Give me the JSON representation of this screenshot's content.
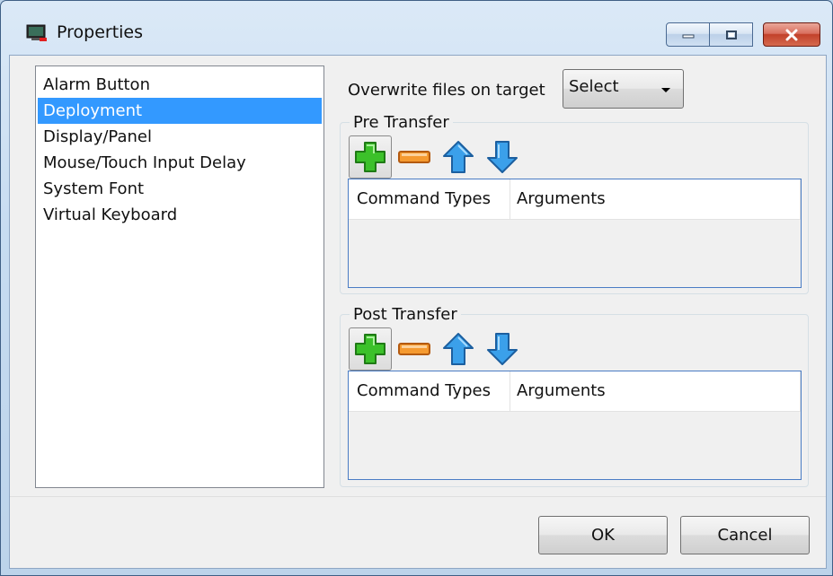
{
  "window": {
    "title": "Properties",
    "icon": "computer-monitor-icon"
  },
  "titlebar_buttons": {
    "minimize": "minimize-icon",
    "maximize": "restore-icon",
    "close": "close-icon"
  },
  "categories": {
    "items": [
      {
        "label": "Alarm Button",
        "selected": false
      },
      {
        "label": "Deployment",
        "selected": true
      },
      {
        "label": "Display/Panel",
        "selected": false
      },
      {
        "label": "Mouse/Touch Input Delay",
        "selected": false
      },
      {
        "label": "System Font",
        "selected": false
      },
      {
        "label": "Virtual Keyboard",
        "selected": false
      }
    ]
  },
  "deployment": {
    "overwrite_label": "Overwrite files on target",
    "overwrite_value": "Select",
    "pre_transfer": {
      "title": "Pre Transfer",
      "toolbar": [
        "add-icon",
        "remove-icon",
        "move-up-icon",
        "move-down-icon"
      ],
      "columns": [
        "Command Types",
        "Arguments"
      ],
      "rows": []
    },
    "post_transfer": {
      "title": "Post Transfer",
      "toolbar": [
        "add-icon",
        "remove-icon",
        "move-up-icon",
        "move-down-icon"
      ],
      "columns": [
        "Command Types",
        "Arguments"
      ],
      "rows": []
    }
  },
  "buttons": {
    "ok": "OK",
    "cancel": "Cancel"
  },
  "colors": {
    "selection": "#3399ff",
    "close_button": "#c2412a",
    "add_green": "#2fae1f",
    "remove_orange": "#f08a24",
    "arrow_blue": "#2e8fe0"
  }
}
